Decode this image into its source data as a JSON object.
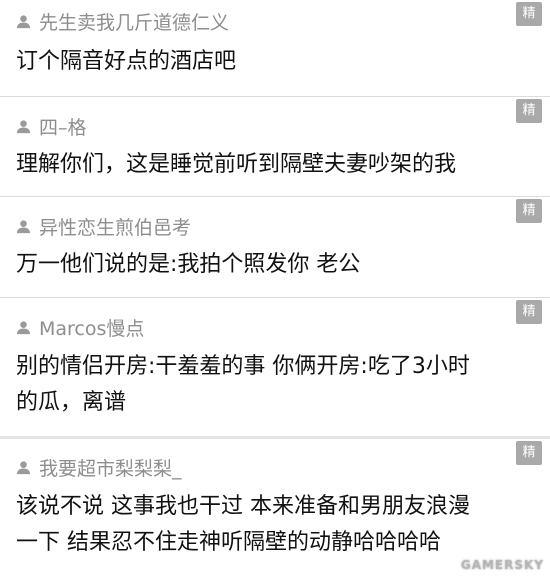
{
  "comments": [
    {
      "username": "先生卖我几斤道德仁义",
      "lines": [
        "订个隔音好点的酒店吧"
      ],
      "badge": "精"
    },
    {
      "username": "四–格",
      "lines": [
        "理解你们，这是睡觉前听到隔壁夫妻吵架的我"
      ],
      "badge": "精"
    },
    {
      "username": "异性恋生煎伯邑考",
      "lines": [
        "万一他们说的是:我拍个照发你 老公"
      ],
      "badge": "精"
    },
    {
      "username": "Marcos慢点",
      "lines": [
        "别的情侣开房:干羞羞的事 你俩开房:吃了3小时",
        "的瓜，离谱"
      ],
      "badge": "精"
    },
    {
      "username": "我要超市梨梨梨_",
      "lines": [
        "该说不说 这事我也干过 本来准备和男朋友浪漫",
        "一下 结果忍不住走神听隔壁的动静哈哈哈哈"
      ],
      "badge": "精"
    }
  ],
  "watermark": "GAMERSKY",
  "colors": {
    "username": "#8e8e8e",
    "text": "#111111",
    "badge": "#a9a9a9",
    "divider": "#dcdcdc"
  }
}
